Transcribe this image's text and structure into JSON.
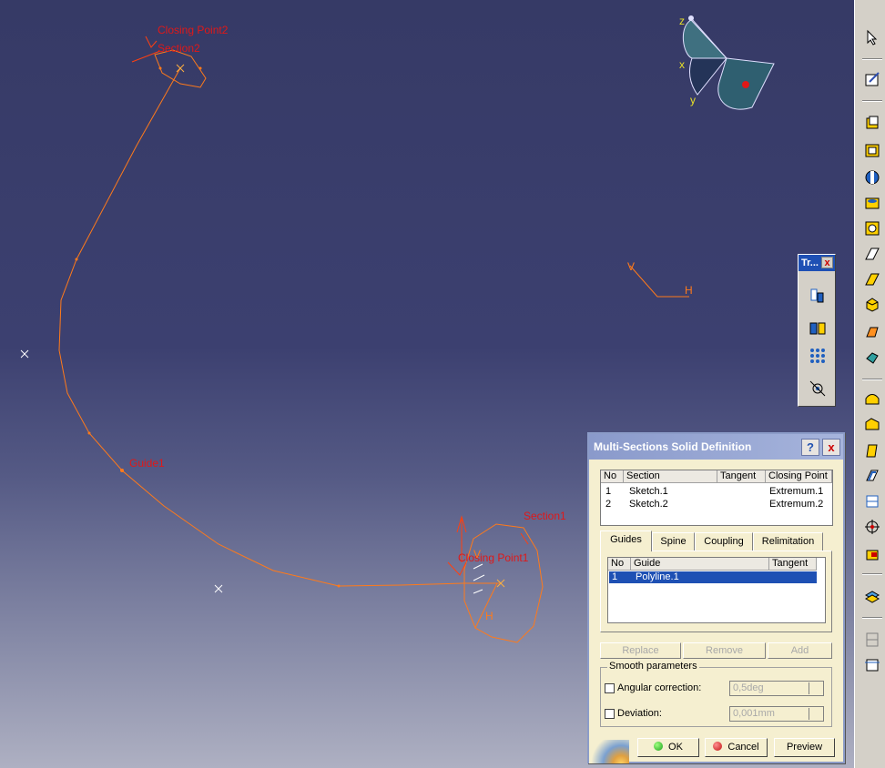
{
  "viewport": {
    "geometry_labels": {
      "closing_point2": "Closing Point2",
      "section2": "Section2",
      "guide1": "Guide1",
      "section1": "Section1",
      "closing_point1": "Closing Point1"
    },
    "compass_axes": {
      "z": "z",
      "x": "x",
      "y": "y"
    },
    "sketch_axes": {
      "v": "V",
      "h": "H"
    },
    "section1_axes": {
      "v": "V",
      "h": "H"
    }
  },
  "tools_palette": {
    "title": "Tr...",
    "close": "x"
  },
  "dialog": {
    "title": "Multi-Sections Solid Definition",
    "help_btn": "?",
    "close_btn": "x",
    "sections_table": {
      "headers": [
        "No",
        "Section",
        "Tangent",
        "Closing Point"
      ],
      "rows": [
        {
          "no": "1",
          "section": "Sketch.1",
          "tangent": "",
          "closing_point": "Extremum.1"
        },
        {
          "no": "2",
          "section": "Sketch.2",
          "tangent": "",
          "closing_point": "Extremum.2"
        }
      ]
    },
    "tabs": [
      "Guides",
      "Spine",
      "Coupling",
      "Relimitation"
    ],
    "active_tab": "Guides",
    "guides_table": {
      "headers": [
        "No",
        "Guide",
        "Tangent"
      ],
      "rows": [
        {
          "no": "1",
          "guide": "Polyline.1",
          "tangent": ""
        }
      ]
    },
    "list_buttons": [
      "Replace",
      "Remove",
      "Add"
    ],
    "smooth": {
      "title": "Smooth parameters",
      "angular_label": "Angular correction:",
      "angular_value": "0,5deg",
      "deviation_label": "Deviation:",
      "deviation_value": "0,001mm"
    },
    "ok": "OK",
    "cancel": "Cancel",
    "preview": "Preview"
  },
  "colors": {
    "geometry": "#ff7a1a",
    "label": "#e01818",
    "selection": "#1e50b4",
    "dialog_bg": "#f5efd0"
  }
}
